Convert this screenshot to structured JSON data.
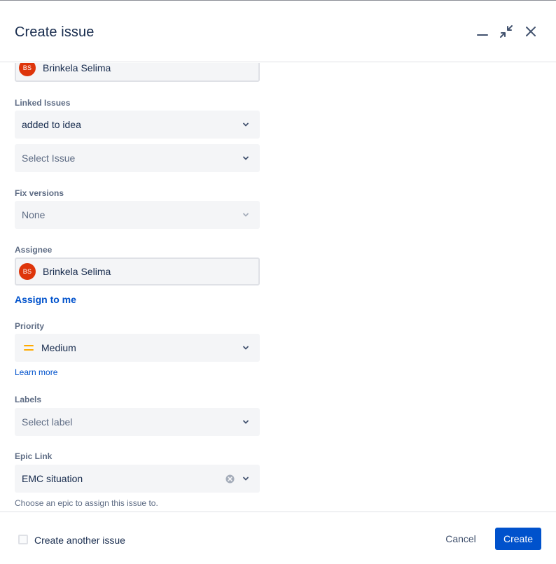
{
  "header": {
    "title": "Create issue",
    "icons": [
      "minimize-icon",
      "collapse-icon",
      "close-icon"
    ]
  },
  "reporter": {
    "avatar_initials": "BS",
    "value": "Brinkela Selima"
  },
  "linked_issues": {
    "label": "Linked Issues",
    "relation_value": "added to idea",
    "issue_placeholder": "Select Issue"
  },
  "fix_versions": {
    "label": "Fix versions",
    "value": "None"
  },
  "assignee": {
    "label": "Assignee",
    "avatar_initials": "BS",
    "value": "Brinkela Selima",
    "assign_to_me": "Assign to me"
  },
  "priority": {
    "label": "Priority",
    "value": "Medium",
    "learn_more": "Learn more",
    "icon_color": "#ffab00"
  },
  "labels": {
    "label": "Labels",
    "placeholder": "Select label"
  },
  "epic_link": {
    "label": "Epic Link",
    "value": "EMC situation",
    "helper": "Choose an epic to assign this issue to."
  },
  "footer": {
    "create_another_label": "Create another issue",
    "cancel_label": "Cancel",
    "create_label": "Create"
  },
  "colors": {
    "primary": "#0052cc",
    "avatar": "#de350b",
    "text": "#172b4d",
    "subtle": "#5e6c84"
  }
}
